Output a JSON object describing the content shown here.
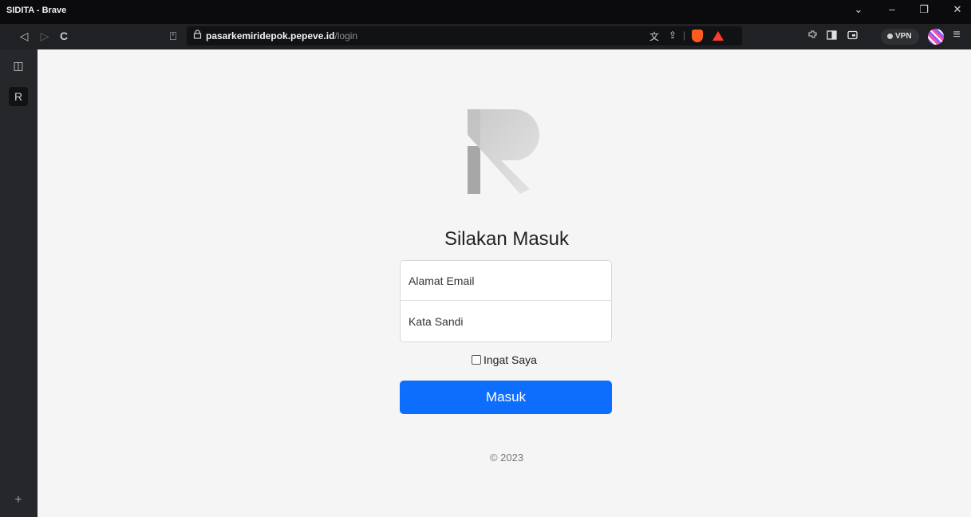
{
  "window": {
    "title": "SIDITA - Brave",
    "chevron": "⌄",
    "minimize": "–",
    "restore": "❐",
    "close": "✕"
  },
  "toolbar": {
    "back": "◁",
    "forward": "▷",
    "reload": "C",
    "bookmark": "⍞",
    "url_host": "pasarkemiridepok.pepeve.id",
    "url_path": "/login",
    "translate": "文",
    "share": "⇪",
    "vpn_label": "VPN",
    "menu": "≡"
  },
  "sidebar": {
    "panel_icon": "◫",
    "app_icon": "R",
    "add": "+"
  },
  "login": {
    "heading": "Silakan Masuk",
    "email_placeholder": "Alamat Email",
    "password_placeholder": "Kata Sandi",
    "remember_label": "Ingat Saya",
    "submit_label": "Masuk",
    "copyright": "© 2023"
  },
  "colors": {
    "primary": "#0d6efd",
    "page_bg": "#f5f5f5",
    "browser_dark": "#202124"
  }
}
